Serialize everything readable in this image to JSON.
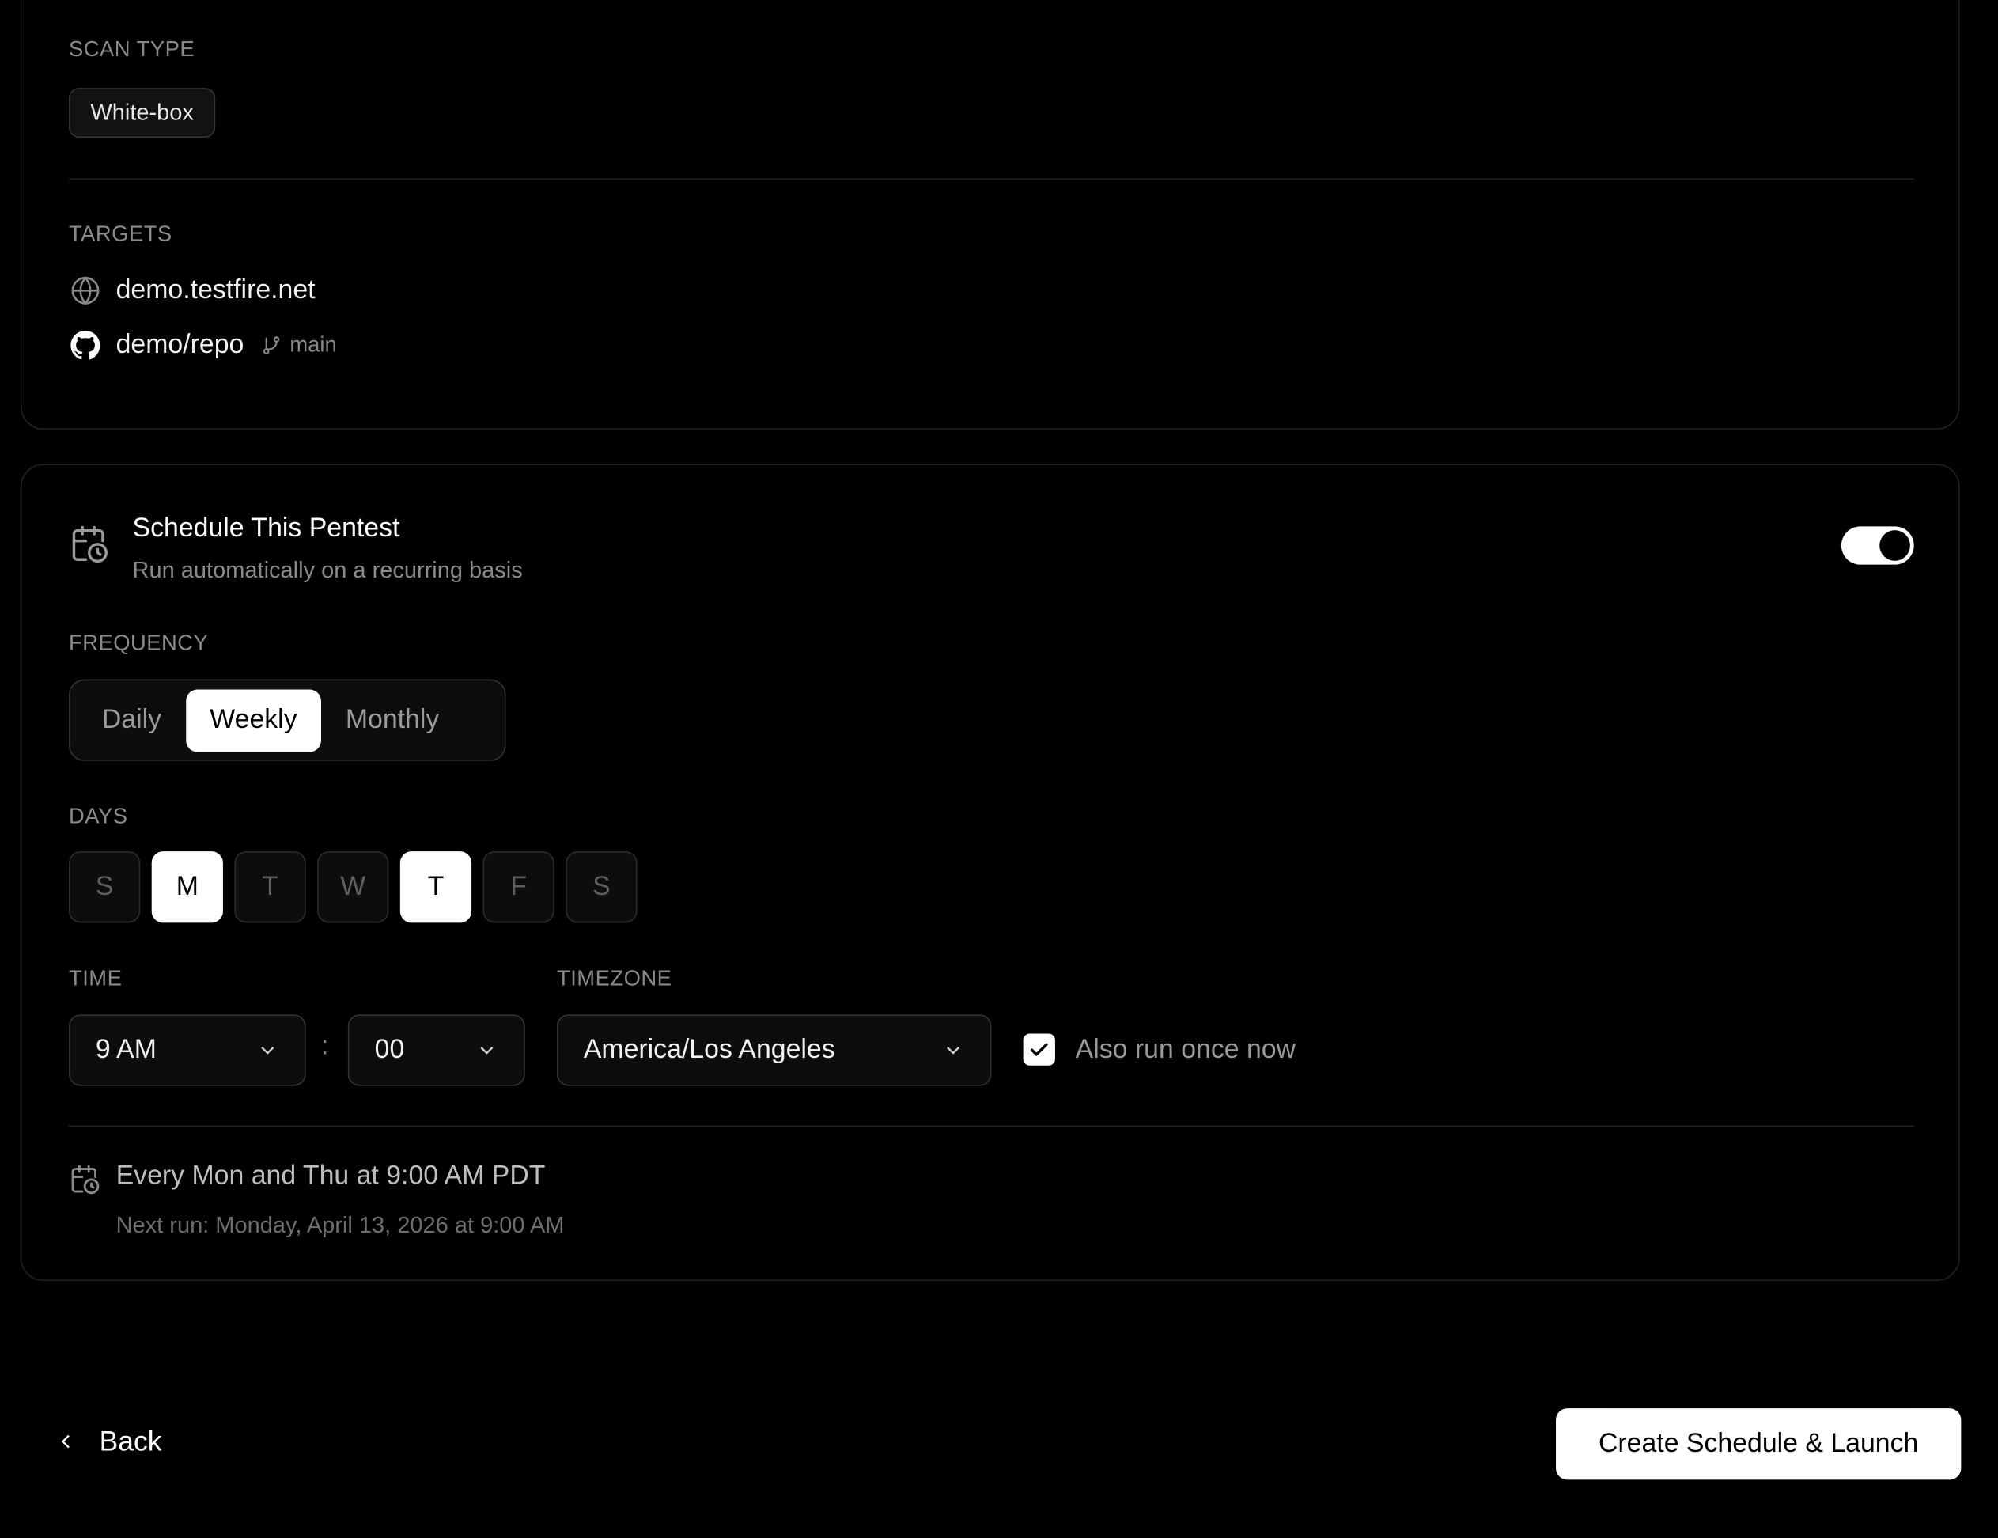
{
  "scan_type": {
    "label": "SCAN TYPE",
    "value": "White-box"
  },
  "targets": {
    "label": "TARGETS",
    "items": [
      {
        "icon": "globe-icon",
        "name": "demo.testfire.net"
      },
      {
        "icon": "github-icon",
        "name": "demo/repo",
        "branch": "main",
        "branch_icon": "git-branch-icon"
      }
    ]
  },
  "schedule": {
    "icon": "calendar-clock-icon",
    "title": "Schedule This Pentest",
    "subtitle": "Run automatically on a recurring basis",
    "enabled": true,
    "frequency": {
      "label": "FREQUENCY",
      "options": [
        "Daily",
        "Weekly",
        "Monthly"
      ],
      "selected": "Weekly"
    },
    "days": {
      "label": "DAYS",
      "items": [
        {
          "letter": "S",
          "selected": false
        },
        {
          "letter": "M",
          "selected": true
        },
        {
          "letter": "T",
          "selected": false
        },
        {
          "letter": "W",
          "selected": false
        },
        {
          "letter": "T",
          "selected": true
        },
        {
          "letter": "F",
          "selected": false
        },
        {
          "letter": "S",
          "selected": false
        }
      ]
    },
    "time": {
      "label": "TIME",
      "hour": "9 AM",
      "separator": ":",
      "minute": "00"
    },
    "timezone": {
      "label": "TIMEZONE",
      "value": "America/Los Angeles"
    },
    "run_now": {
      "checked": true,
      "label": "Also run once now"
    },
    "summary": "Every Mon and Thu at 9:00 AM PDT",
    "next_run": "Next run: Monday, April 13, 2026 at 9:00 AM"
  },
  "footer": {
    "back_label": "Back",
    "launch_label": "Create Schedule & Launch"
  },
  "colors": {
    "background": "#000000",
    "accent": "#ffffff",
    "muted_text": "#8a8a8a",
    "border": "#222222"
  }
}
